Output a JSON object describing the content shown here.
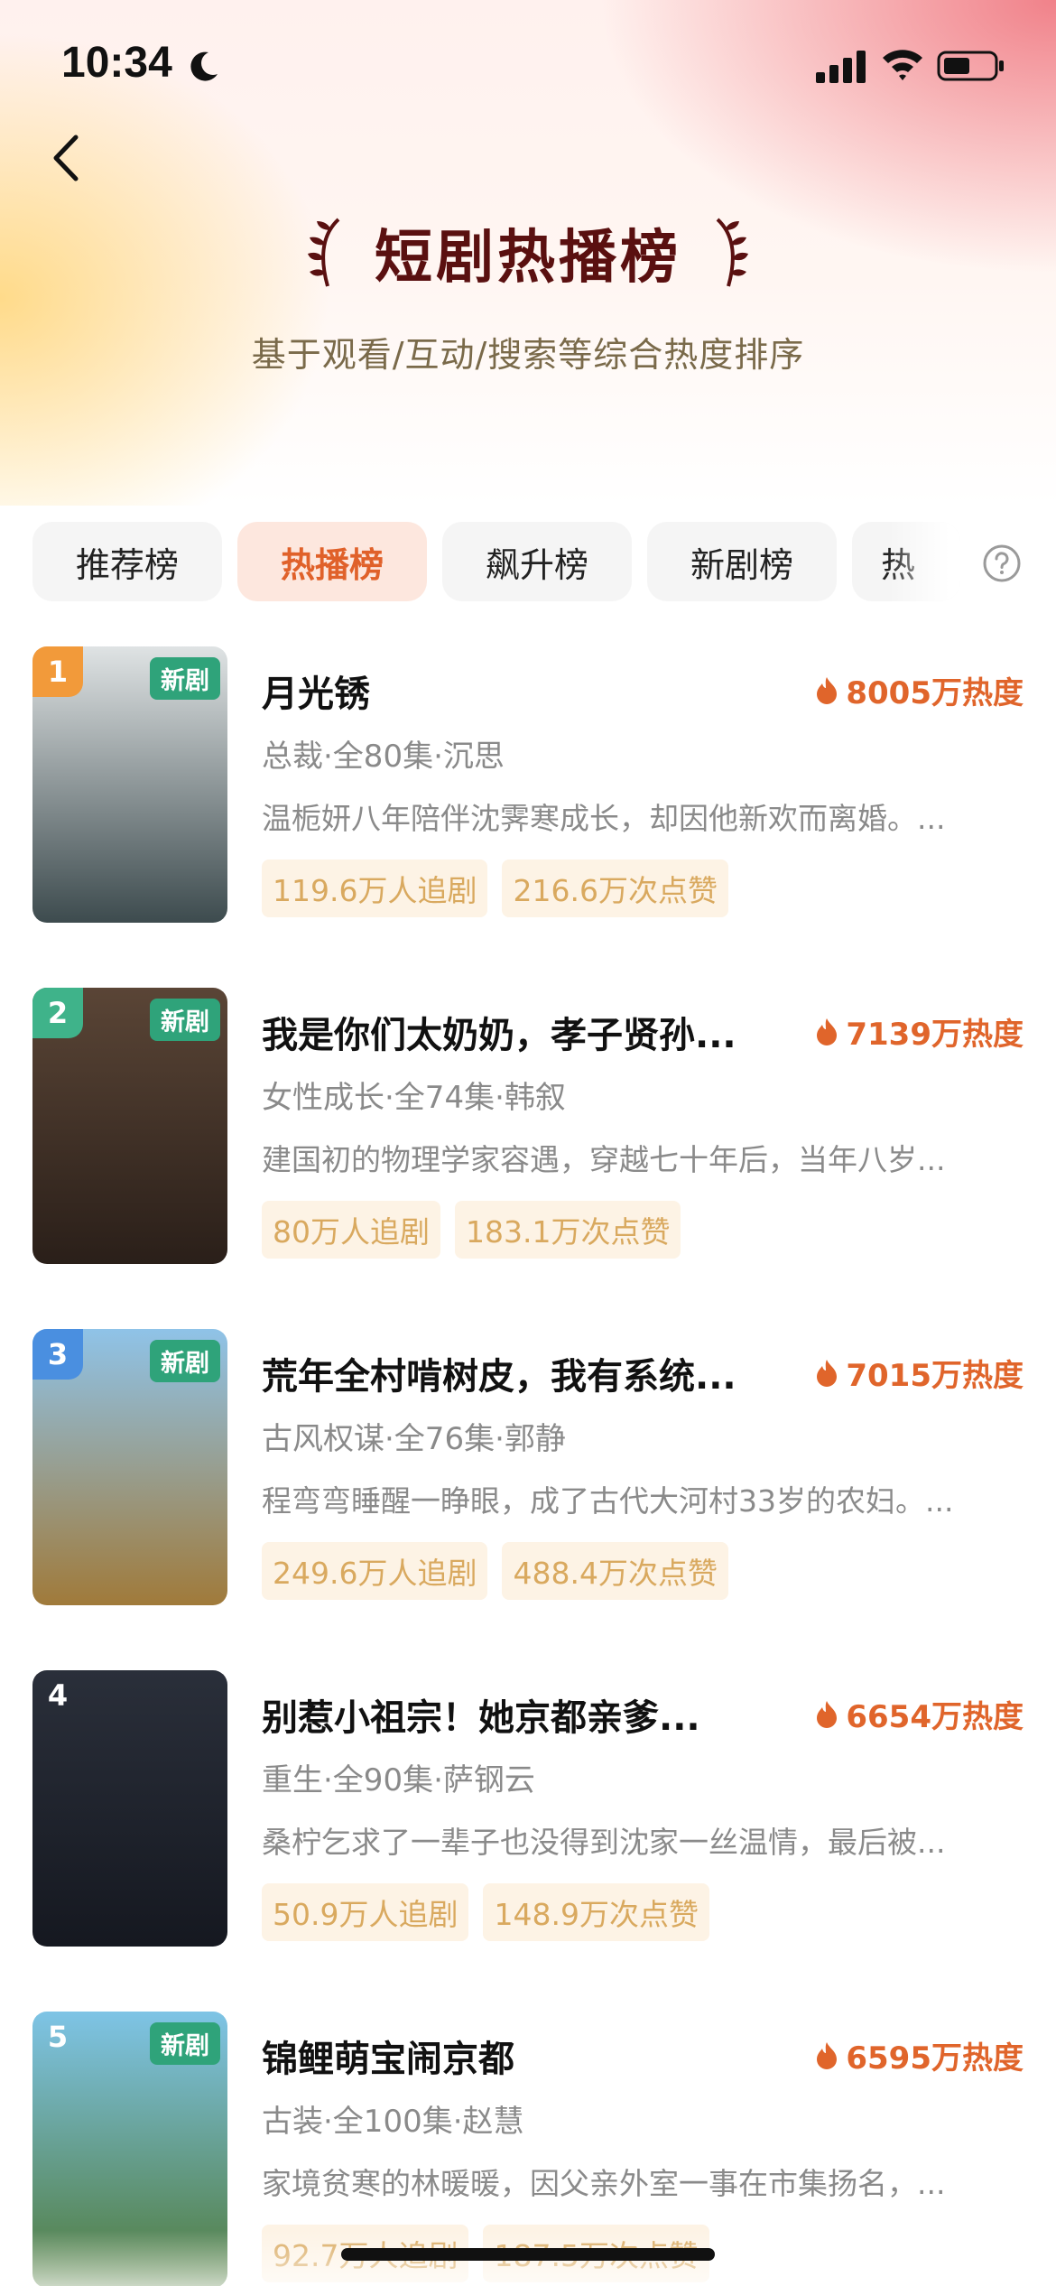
{
  "status_bar": {
    "time": "10:34"
  },
  "header": {
    "title": "短剧热播榜",
    "subtitle": "基于观看/互动/搜索等综合热度排序"
  },
  "tabs": [
    {
      "label": "推荐榜",
      "active": false
    },
    {
      "label": "热播榜",
      "active": true
    },
    {
      "label": "飙升榜",
      "active": false
    },
    {
      "label": "新剧榜",
      "active": false
    },
    {
      "label": "热",
      "active": false
    }
  ],
  "items": [
    {
      "rank": "1",
      "badge": "新剧",
      "title": "月光锈",
      "heat": "8005万热度",
      "meta": "总裁·全80集·沉思",
      "desc": "温栀妍八年陪伴沈霁寒成长，却因他新欢而离婚。...",
      "followers": "119.6万人追剧",
      "likes": "216.6万次点赞",
      "rank_color": "#f29a3a",
      "poster_top": "#dfe3e4",
      "poster_bottom": "#3d4b4e"
    },
    {
      "rank": "2",
      "badge": "新剧",
      "title": "我是你们太奶奶，孝子贤孙...",
      "heat": "7139万热度",
      "meta": "女性成长·全74集·韩叙",
      "desc": "建国初的物理学家容遇，穿越七十年后，当年八岁...",
      "followers": "80万人追剧",
      "likes": "183.1万次点赞",
      "rank_color": "#3fb38a",
      "poster_top": "#5a4536",
      "poster_bottom": "#2a1f19"
    },
    {
      "rank": "3",
      "badge": "新剧",
      "title": "荒年全村啃树皮，我有系统...",
      "heat": "7015万热度",
      "meta": "古风权谋·全76集·郭静",
      "desc": "程弯弯睡醒一睁眼，成了古代大河村33岁的农妇。...",
      "followers": "249.6万人追剧",
      "likes": "488.4万次点赞",
      "rank_color": "#4a8fe0",
      "poster_top": "#8fc3e8",
      "poster_bottom": "#a07a3a"
    },
    {
      "rank": "4",
      "badge": "",
      "title": "别惹小祖宗！她京都亲爹...",
      "heat": "6654万热度",
      "meta": "重生·全90集·萨钢云",
      "desc": "桑柠乞求了一辈子也没得到沈家一丝温情，最后被...",
      "followers": "50.9万人追剧",
      "likes": "148.9万次点赞",
      "rank_color": "rgba(0,0,0,0)",
      "poster_top": "#2a2f3a",
      "poster_bottom": "#151820"
    },
    {
      "rank": "5",
      "badge": "新剧",
      "title": "锦鲤萌宝闹京都",
      "heat": "6595万热度",
      "meta": "古装·全100集·赵慧",
      "desc": "家境贫寒的林暖暖，因父亲外室一事在市集扬名，...",
      "followers": "92.7万人追剧",
      "likes": "187.5万次点赞",
      "rank_color": "rgba(0,0,0,0)",
      "poster_top": "#7ec4e6",
      "poster_bottom": "#4f7a3a"
    }
  ]
}
